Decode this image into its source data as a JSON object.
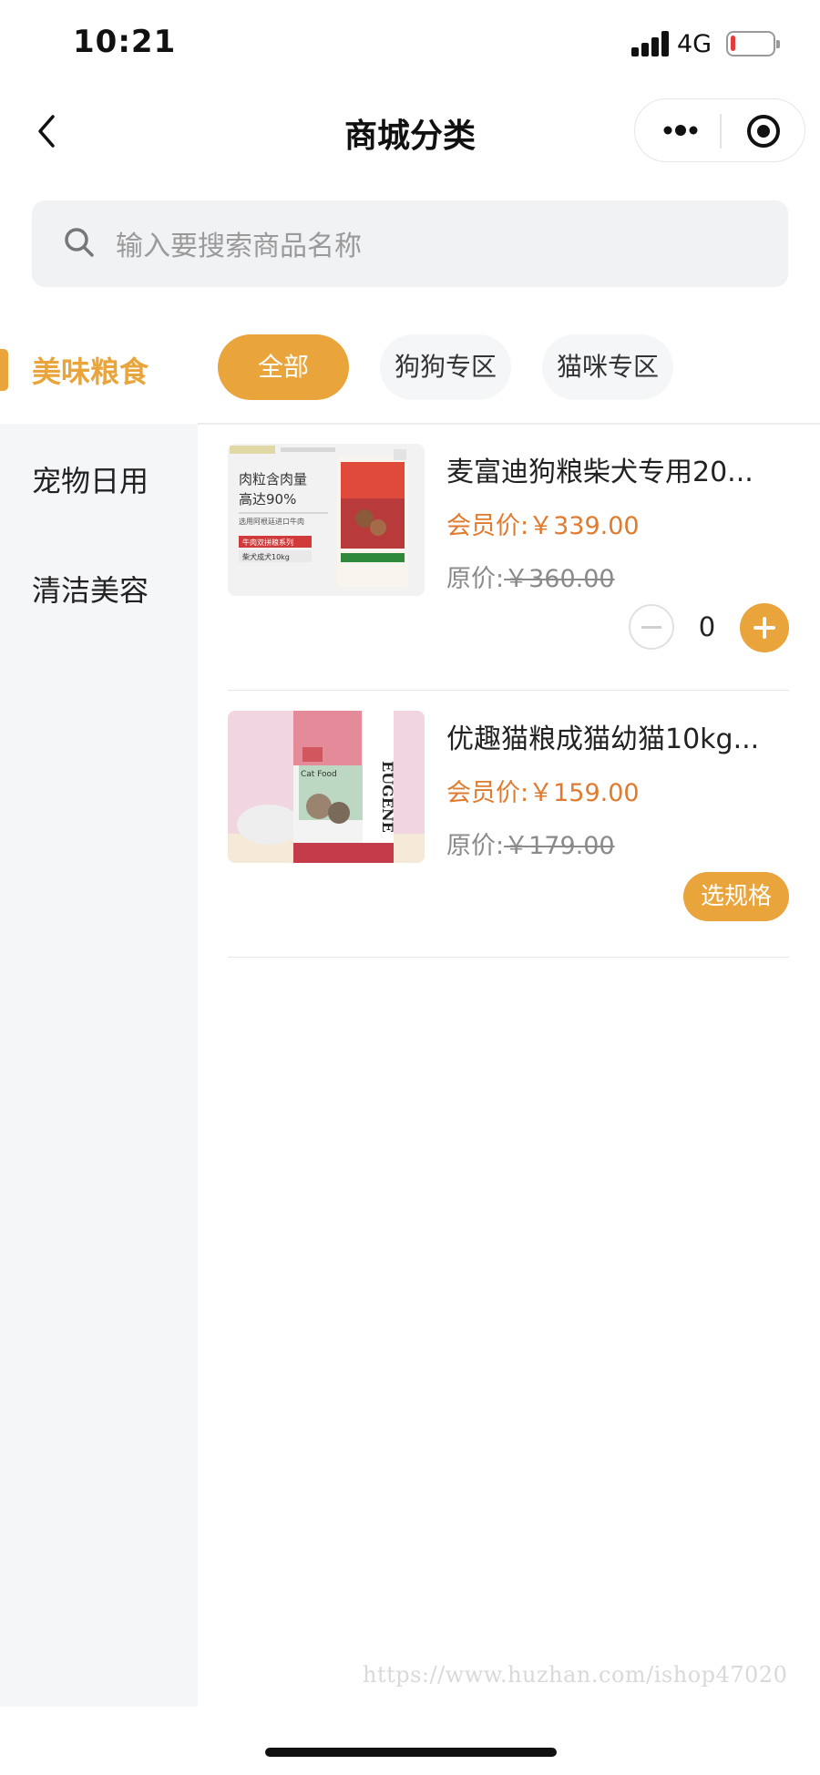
{
  "status_bar": {
    "time": "10:21",
    "network": "4G",
    "battery_level": 0.1
  },
  "nav": {
    "title": "商城分类"
  },
  "search": {
    "placeholder": "输入要搜索商品名称"
  },
  "sidebar": {
    "items": [
      {
        "label": "美味粮食",
        "active": true
      },
      {
        "label": "宠物日用",
        "active": false
      },
      {
        "label": "清洁美容",
        "active": false
      }
    ]
  },
  "tabs": [
    {
      "label": "全部",
      "active": true
    },
    {
      "label": "狗狗专区",
      "active": false
    },
    {
      "label": "猫咪专区",
      "active": false
    }
  ],
  "products": [
    {
      "name": "麦富迪狗粮柴犬专用20...",
      "member_prefix": "会员价:",
      "member_price": "￥339.00",
      "orig_prefix": "原价:",
      "orig_price": "￥360.00",
      "quantity": "0",
      "image": {
        "line1": "肉粒含肉量",
        "line2": "高达90%",
        "line3": "选用阿根廷进口牛肉",
        "tag1": "牛肉双拼粮系列",
        "tag2": "柴犬成犬10kg"
      }
    },
    {
      "name": "优趣猫粮成猫幼猫10kg...",
      "member_prefix": "会员价:",
      "member_price": "￥159.00",
      "orig_prefix": "原价:",
      "orig_price": "￥179.00",
      "spec_label": "选规格",
      "image": {
        "brand": "EUGENE",
        "sub": "Cat Food"
      }
    }
  ],
  "watermark": "https://www.huzhan.com/ishop47020",
  "colors": {
    "accent": "#e9a43b",
    "price": "#e07a2e",
    "sidebar_bg": "#f5f6f8"
  }
}
